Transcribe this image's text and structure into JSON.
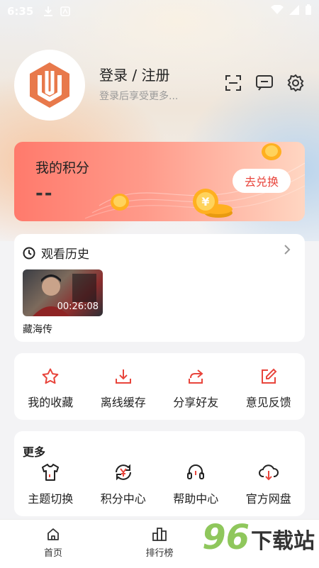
{
  "status_bar": {
    "time": "6:35"
  },
  "profile": {
    "login_label": "登录 / 注册",
    "login_hint": "登录后享受更多..."
  },
  "points": {
    "label": "我的积分",
    "value": "--",
    "redeem_label": "去兑换"
  },
  "history": {
    "title": "观看历史",
    "items": [
      {
        "title": "藏海传",
        "duration": "00:26:08"
      }
    ]
  },
  "actions": [
    {
      "label": "我的收藏",
      "icon": "star-icon"
    },
    {
      "label": "离线缓存",
      "icon": "download-icon"
    },
    {
      "label": "分享好友",
      "icon": "share-icon"
    },
    {
      "label": "意见反馈",
      "icon": "edit-icon"
    }
  ],
  "more": {
    "title": "更多",
    "items": [
      {
        "label": "主题切换",
        "icon": "tshirt-icon"
      },
      {
        "label": "积分中心",
        "icon": "coin-refresh-icon"
      },
      {
        "label": "帮助中心",
        "icon": "headset-icon"
      },
      {
        "label": "官方网盘",
        "icon": "cloud-download-icon"
      }
    ]
  },
  "tabbar": [
    {
      "label": "首页",
      "icon": "home-icon"
    },
    {
      "label": "排行榜",
      "icon": "ranking-icon"
    }
  ],
  "watermark": {
    "number": "96",
    "text": "下载站"
  },
  "colors": {
    "accent": "#e8453c",
    "brand_orange": "#e8794b",
    "watermark_green": "#8fc75c"
  }
}
